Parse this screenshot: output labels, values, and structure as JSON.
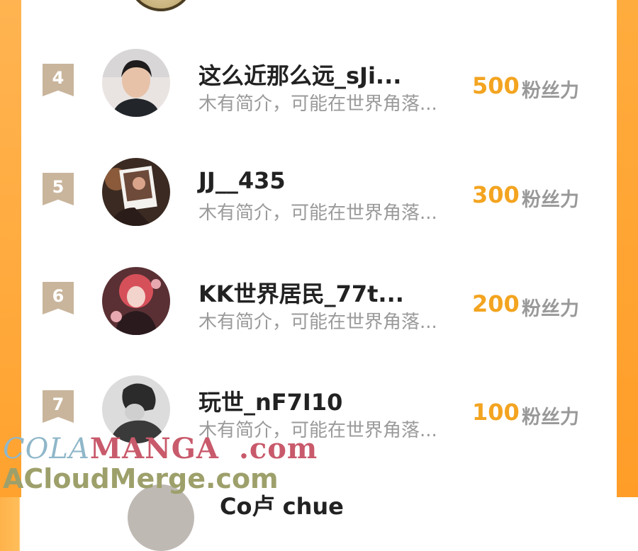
{
  "rows": [
    {
      "rank": "4",
      "name": "这么近那么远_sJi...",
      "bio": "木有简介，可能在世界角落...",
      "score": "500",
      "unit": "粉丝力"
    },
    {
      "rank": "5",
      "name": "JJ__435",
      "bio": "木有简介，可能在世界角落...",
      "score": "300",
      "unit": "粉丝力"
    },
    {
      "rank": "6",
      "name": "KK世界居民_77t...",
      "bio": "木有简介，可能在世界角落...",
      "score": "200",
      "unit": "粉丝力"
    },
    {
      "rank": "7",
      "name": "玩世_nF7I10",
      "bio": "木有简介，可能在世界角落...",
      "score": "100",
      "unit": "粉丝力"
    }
  ],
  "watermark": {
    "line1_a": "COLA",
    "line1_b": "MANGA",
    "line1_c": ".com",
    "line2": "ACloudMerge.com"
  },
  "partial_next": {
    "name": "Co卢 chue"
  },
  "colors": {
    "accent": "#f3a420",
    "rank_badge": "#c9b59c",
    "border_orange": "#ffa22e"
  }
}
